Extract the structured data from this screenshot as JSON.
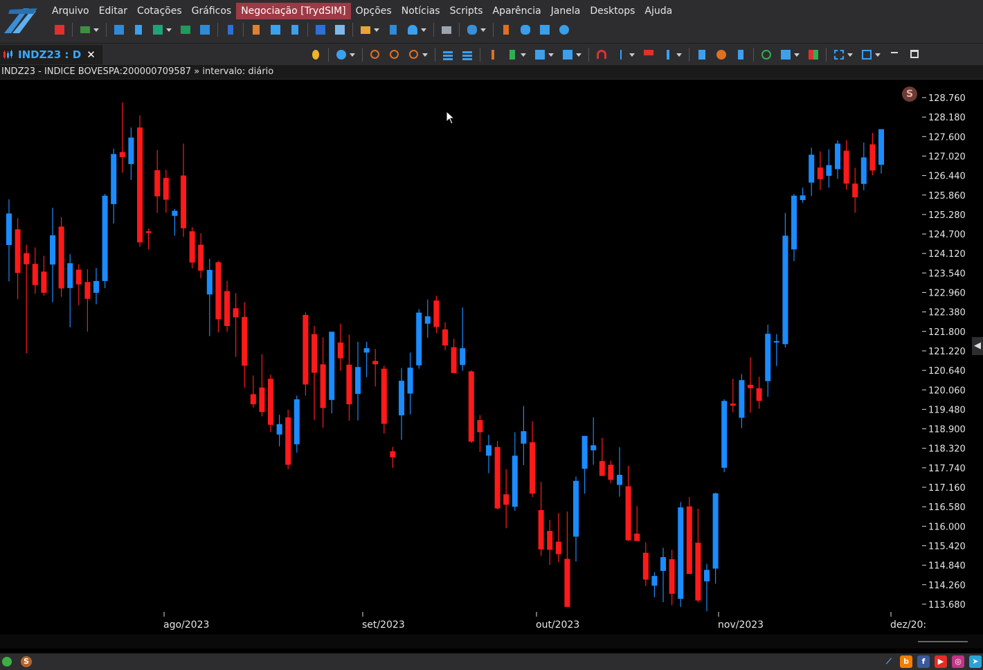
{
  "menu": {
    "items": [
      "Arquivo",
      "Editar",
      "Cotações",
      "Gráficos",
      "Negociação [TrydSIM]",
      "Opções",
      "Notícias",
      "Scripts",
      "Aparência",
      "Janela",
      "Desktops",
      "Ajuda"
    ],
    "active_index": 4
  },
  "tab": {
    "title": "INDZ23 : D",
    "close_icon": "close-icon"
  },
  "chart_info": "INDZ23 - INDICE BOVESPA:200000709587 » intervalo: diário",
  "badges": {
    "study_badge": "S",
    "status_badge": "S"
  },
  "colors": {
    "up": "#1a8cff",
    "down": "#ff1a1a",
    "background": "#000000",
    "chrome": "#2d2d30",
    "active_menu": "#9e3a45"
  },
  "chart_data": {
    "type": "candlestick",
    "x_labels": [
      "ago/2023",
      "set/2023",
      "out/2023",
      "nov/2023",
      "dez/20:"
    ],
    "y_ticks": [
      128760,
      128180,
      127600,
      127020,
      126440,
      125860,
      125280,
      124700,
      124120,
      123540,
      122960,
      122380,
      121800,
      121220,
      120640,
      120060,
      119480,
      118900,
      118320,
      117740,
      117160,
      116580,
      116000,
      115420,
      114840,
      114260,
      113680
    ],
    "y_tick_labels": [
      "128.760",
      "128.180",
      "127.600",
      "127.020",
      "126.440",
      "125.860",
      "125.280",
      "124.700",
      "124.120",
      "123.540",
      "122.960",
      "122.380",
      "121.800",
      "121.220",
      "120.640",
      "120.060",
      "119.480",
      "118.900",
      "118.320",
      "117.740",
      "117.160",
      "116.580",
      "116.000",
      "115.420",
      "114.840",
      "114.260",
      "113.680"
    ],
    "candles": [
      {
        "o": 124370,
        "h": 125730,
        "l": 123290,
        "c": 125310
      },
      {
        "o": 124840,
        "h": 125170,
        "l": 122760,
        "c": 123540
      },
      {
        "o": 124130,
        "h": 124380,
        "l": 121150,
        "c": 123800
      },
      {
        "o": 123810,
        "h": 124300,
        "l": 122920,
        "c": 123180
      },
      {
        "o": 123580,
        "h": 124050,
        "l": 122860,
        "c": 122950
      },
      {
        "o": 123790,
        "h": 125480,
        "l": 122670,
        "c": 124660
      },
      {
        "o": 124920,
        "h": 125200,
        "l": 122830,
        "c": 123080
      },
      {
        "o": 123090,
        "h": 124100,
        "l": 121920,
        "c": 123830
      },
      {
        "o": 123640,
        "h": 123800,
        "l": 122580,
        "c": 123200
      },
      {
        "o": 123270,
        "h": 123650,
        "l": 121790,
        "c": 122770
      },
      {
        "o": 122950,
        "h": 123690,
        "l": 122610,
        "c": 123300
      },
      {
        "o": 123300,
        "h": 125890,
        "l": 123090,
        "c": 125840
      },
      {
        "o": 125590,
        "h": 127240,
        "l": 125010,
        "c": 127080
      },
      {
        "o": 127140,
        "h": 128610,
        "l": 126520,
        "c": 126990
      },
      {
        "o": 126780,
        "h": 127870,
        "l": 126310,
        "c": 127570
      },
      {
        "o": 127870,
        "h": 128230,
        "l": 124320,
        "c": 124450
      },
      {
        "o": 124780,
        "h": 124860,
        "l": 124240,
        "c": 124730
      },
      {
        "o": 126600,
        "h": 127200,
        "l": 125330,
        "c": 125820
      },
      {
        "o": 126370,
        "h": 126610,
        "l": 125330,
        "c": 125720
      },
      {
        "o": 125240,
        "h": 125450,
        "l": 124650,
        "c": 125390
      },
      {
        "o": 126440,
        "h": 127390,
        "l": 124610,
        "c": 124870
      },
      {
        "o": 124780,
        "h": 124900,
        "l": 123680,
        "c": 123850
      },
      {
        "o": 124380,
        "h": 124720,
        "l": 123380,
        "c": 123610
      },
      {
        "o": 122900,
        "h": 123960,
        "l": 121660,
        "c": 123630
      },
      {
        "o": 123860,
        "h": 123900,
        "l": 121770,
        "c": 122160
      },
      {
        "o": 123000,
        "h": 123300,
        "l": 121790,
        "c": 121960
      },
      {
        "o": 122490,
        "h": 122940,
        "l": 121040,
        "c": 122220
      },
      {
        "o": 122230,
        "h": 122670,
        "l": 120130,
        "c": 120780
      },
      {
        "o": 119930,
        "h": 120490,
        "l": 119530,
        "c": 119630
      },
      {
        "o": 120130,
        "h": 121120,
        "l": 119270,
        "c": 119400
      },
      {
        "o": 120390,
        "h": 120510,
        "l": 118800,
        "c": 119020
      },
      {
        "o": 118730,
        "h": 119320,
        "l": 118380,
        "c": 119040
      },
      {
        "o": 119240,
        "h": 119470,
        "l": 117700,
        "c": 117830
      },
      {
        "o": 118440,
        "h": 119890,
        "l": 118190,
        "c": 119780
      },
      {
        "o": 122290,
        "h": 122370,
        "l": 119890,
        "c": 120220
      },
      {
        "o": 121720,
        "h": 121960,
        "l": 119160,
        "c": 120570
      },
      {
        "o": 120820,
        "h": 121620,
        "l": 118930,
        "c": 119520
      },
      {
        "o": 119760,
        "h": 121780,
        "l": 119360,
        "c": 121790
      },
      {
        "o": 121470,
        "h": 122030,
        "l": 120630,
        "c": 121000
      },
      {
        "o": 120810,
        "h": 121700,
        "l": 119140,
        "c": 119630
      },
      {
        "o": 119940,
        "h": 121490,
        "l": 119150,
        "c": 120740
      },
      {
        "o": 121170,
        "h": 121490,
        "l": 120440,
        "c": 121300
      },
      {
        "o": 120920,
        "h": 121280,
        "l": 120160,
        "c": 120820
      },
      {
        "o": 120690,
        "h": 120780,
        "l": 118760,
        "c": 119050
      },
      {
        "o": 118230,
        "h": 118360,
        "l": 117740,
        "c": 118050
      },
      {
        "o": 119300,
        "h": 120710,
        "l": 118570,
        "c": 120330
      },
      {
        "o": 119950,
        "h": 121170,
        "l": 119330,
        "c": 120720
      },
      {
        "o": 120790,
        "h": 122460,
        "l": 120690,
        "c": 122360
      },
      {
        "o": 122030,
        "h": 122750,
        "l": 121610,
        "c": 122250
      },
      {
        "o": 122720,
        "h": 122860,
        "l": 121750,
        "c": 121930
      },
      {
        "o": 121860,
        "h": 122070,
        "l": 121240,
        "c": 121380
      },
      {
        "o": 121330,
        "h": 121580,
        "l": 120690,
        "c": 120560
      },
      {
        "o": 120800,
        "h": 122510,
        "l": 120630,
        "c": 121300
      },
      {
        "o": 120610,
        "h": 120640,
        "l": 118480,
        "c": 118520
      },
      {
        "o": 119160,
        "h": 119310,
        "l": 118210,
        "c": 118800
      },
      {
        "o": 118100,
        "h": 118720,
        "l": 117580,
        "c": 118410
      },
      {
        "o": 118360,
        "h": 118540,
        "l": 116500,
        "c": 116530
      },
      {
        "o": 116950,
        "h": 117700,
        "l": 115940,
        "c": 116640
      },
      {
        "o": 116580,
        "h": 118800,
        "l": 116460,
        "c": 118100
      },
      {
        "o": 118460,
        "h": 119580,
        "l": 117820,
        "c": 118830
      },
      {
        "o": 118500,
        "h": 119130,
        "l": 116870,
        "c": 116970
      },
      {
        "o": 116480,
        "h": 117320,
        "l": 115120,
        "c": 115310
      },
      {
        "o": 115860,
        "h": 116190,
        "l": 114850,
        "c": 115300
      },
      {
        "o": 115540,
        "h": 116390,
        "l": 114930,
        "c": 115170
      },
      {
        "o": 115030,
        "h": 116440,
        "l": 114650,
        "c": 113600
      },
      {
        "o": 115690,
        "h": 117480,
        "l": 114950,
        "c": 117350
      },
      {
        "o": 117710,
        "h": 118360,
        "l": 116970,
        "c": 118690
      },
      {
        "o": 118260,
        "h": 119240,
        "l": 117830,
        "c": 118410
      },
      {
        "o": 117940,
        "h": 118630,
        "l": 117800,
        "c": 117500
      },
      {
        "o": 117830,
        "h": 117950,
        "l": 117280,
        "c": 117380
      },
      {
        "o": 117230,
        "h": 118350,
        "l": 116880,
        "c": 117530
      },
      {
        "o": 117190,
        "h": 117800,
        "l": 115560,
        "c": 115580
      },
      {
        "o": 115780,
        "h": 116600,
        "l": 115570,
        "c": 115560
      },
      {
        "o": 115210,
        "h": 115520,
        "l": 114220,
        "c": 114410
      },
      {
        "o": 114230,
        "h": 114630,
        "l": 113890,
        "c": 114520
      },
      {
        "o": 114670,
        "h": 115360,
        "l": 113740,
        "c": 115080
      },
      {
        "o": 115020,
        "h": 115300,
        "l": 113650,
        "c": 113990
      },
      {
        "o": 113840,
        "h": 116720,
        "l": 113600,
        "c": 116560
      },
      {
        "o": 116590,
        "h": 116870,
        "l": 114900,
        "c": 114580
      },
      {
        "o": 115510,
        "h": 116520,
        "l": 113730,
        "c": 113790
      },
      {
        "o": 114360,
        "h": 114880,
        "l": 113470,
        "c": 114700
      },
      {
        "o": 114740,
        "h": 117000,
        "l": 114290,
        "c": 116980
      },
      {
        "o": 117740,
        "h": 119780,
        "l": 117610,
        "c": 119730
      },
      {
        "o": 119650,
        "h": 120390,
        "l": 119390,
        "c": 119590
      },
      {
        "o": 119230,
        "h": 120530,
        "l": 118920,
        "c": 120350
      },
      {
        "o": 120210,
        "h": 121030,
        "l": 119380,
        "c": 120110
      },
      {
        "o": 120110,
        "h": 120450,
        "l": 119500,
        "c": 119730
      },
      {
        "o": 120320,
        "h": 122000,
        "l": 119850,
        "c": 121730
      },
      {
        "o": 121500,
        "h": 121720,
        "l": 120770,
        "c": 121510
      },
      {
        "o": 121420,
        "h": 125330,
        "l": 121320,
        "c": 124650
      },
      {
        "o": 124240,
        "h": 125890,
        "l": 123890,
        "c": 125840
      },
      {
        "o": 125710,
        "h": 126080,
        "l": 125630,
        "c": 125850
      },
      {
        "o": 126230,
        "h": 127270,
        "l": 125830,
        "c": 127060
      },
      {
        "o": 126680,
        "h": 127160,
        "l": 126010,
        "c": 126330
      },
      {
        "o": 126430,
        "h": 127220,
        "l": 126080,
        "c": 126750
      },
      {
        "o": 126630,
        "h": 127490,
        "l": 126340,
        "c": 127390
      },
      {
        "o": 127180,
        "h": 127490,
        "l": 126020,
        "c": 126200
      },
      {
        "o": 126200,
        "h": 126670,
        "l": 125330,
        "c": 125790
      },
      {
        "o": 126190,
        "h": 127420,
        "l": 126000,
        "c": 126980
      },
      {
        "o": 127370,
        "h": 127710,
        "l": 126450,
        "c": 126590
      },
      {
        "o": 126760,
        "h": 127310,
        "l": 126500,
        "c": 127820
      }
    ]
  },
  "social": [
    "tryd",
    "blogger",
    "facebook",
    "youtube",
    "instagram",
    "telegram"
  ]
}
